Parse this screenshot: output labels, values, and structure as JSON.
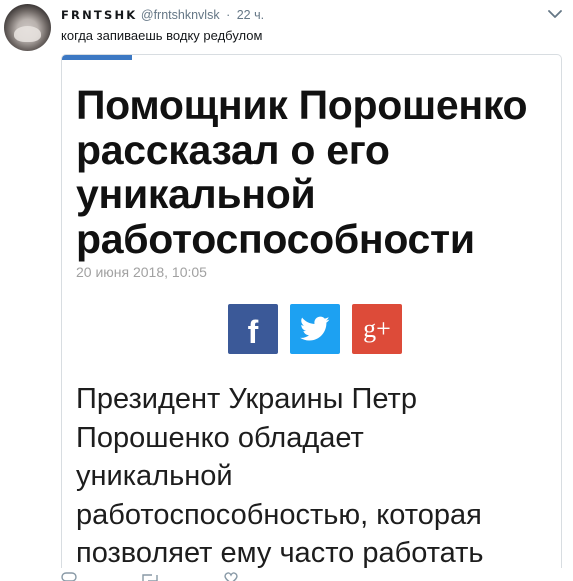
{
  "tweet": {
    "author_name": "FRNTSHK",
    "author_handle": "@frntshknvlsk",
    "separator": "·",
    "time": "22 ч.",
    "text": "когда запиваешь водку редбулом"
  },
  "article": {
    "headline_lines": [
      "Помощник Порошенко",
      "рассказал о его",
      "уникальной",
      "работоспособности"
    ],
    "date": "20 июня 2018, 10:05",
    "share": {
      "facebook_glyph": "f",
      "googleplus_glyph": "g+",
      "colors": {
        "facebook": "#3b5998",
        "twitter": "#1da1f2",
        "googleplus": "#dd4b39"
      }
    },
    "body_lines": [
      "Президент Украины Петр",
      "Порошенко обладает",
      "уникальной",
      "работоспособностью, которая",
      "позволяет ему часто работать"
    ]
  },
  "colors": {
    "accent_bar": "#3c78c3",
    "muted": "#657786"
  },
  "icons": [
    "chevron-down-icon",
    "facebook-icon",
    "twitter-icon",
    "googleplus-icon",
    "reply-icon",
    "retweet-icon",
    "like-icon"
  ]
}
